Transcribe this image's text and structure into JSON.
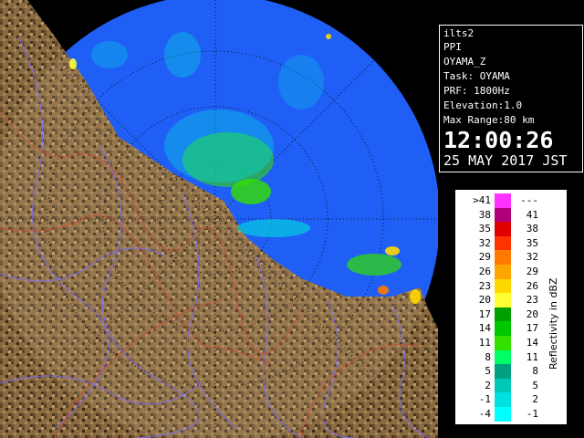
{
  "info": {
    "site": "ilts2",
    "product": "PPI",
    "name": "OYAMA_Z",
    "task": "Task: OYAMA",
    "prf": "PRF: 1800Hz",
    "elevation": "Elevation:1.0",
    "max_range": "Max Range:80 km",
    "time": "12:00:26",
    "date": "25 MAY 2017 JST"
  },
  "legend": {
    "title": "Reflectivity in dBZ",
    "rows": [
      {
        "low": ">41",
        "high": "---",
        "color": "#ff33ff"
      },
      {
        "low": "38",
        "high": "41",
        "color": "#b0007a"
      },
      {
        "low": "35",
        "high": "38",
        "color": "#e00000"
      },
      {
        "low": "32",
        "high": "35",
        "color": "#ff3300"
      },
      {
        "low": "29",
        "high": "32",
        "color": "#ff7a00"
      },
      {
        "low": "26",
        "high": "29",
        "color": "#ffa500"
      },
      {
        "low": "23",
        "high": "26",
        "color": "#ffd800"
      },
      {
        "low": "20",
        "high": "23",
        "color": "#ffff33"
      },
      {
        "low": "17",
        "high": "20",
        "color": "#00a000"
      },
      {
        "low": "14",
        "high": "17",
        "color": "#00c800"
      },
      {
        "low": "11",
        "high": "14",
        "color": "#33e000"
      },
      {
        "low": "8",
        "high": "11",
        "color": "#00ff66"
      },
      {
        "low": "5",
        "high": "8",
        "color": "#00a080"
      },
      {
        "low": "2",
        "high": "5",
        "color": "#00c8b4"
      },
      {
        "low": "-1",
        "high": "2",
        "color": "#00e0e0"
      },
      {
        "low": "-4",
        "high": "-1",
        "color": "#00ffff"
      }
    ]
  },
  "colors": {
    "sea": "#1f5ff5",
    "land": "#8a6a40",
    "land_dark": "#3a2a18",
    "river": "#7a6cff",
    "border": "#c84a3a",
    "range_ring": "#000000"
  }
}
